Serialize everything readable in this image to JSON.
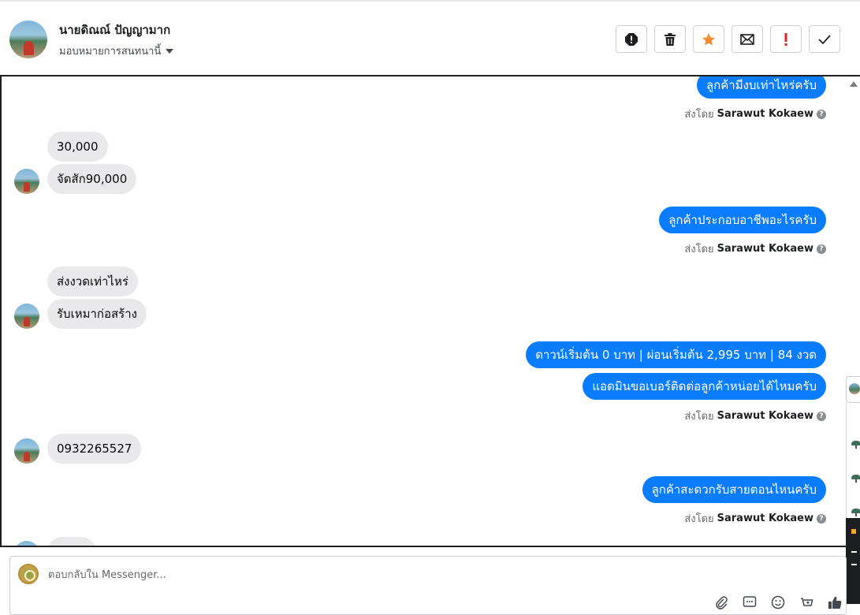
{
  "header": {
    "customer_name": "นายดิณณ์ ปัญญามาก",
    "assign_label": "มอบหมายการสนทนานี้"
  },
  "toolbar": {
    "buttons": [
      {
        "icon": "alert-circle-icon"
      },
      {
        "icon": "trash-icon"
      },
      {
        "icon": "star-icon",
        "color": "#f58e2d"
      },
      {
        "icon": "envelope-icon"
      },
      {
        "icon": "exclamation-icon",
        "color": "#e02424"
      },
      {
        "icon": "check-icon"
      }
    ]
  },
  "conversation": {
    "sent_by_prefix": "ส่งโดย",
    "agent_name": "Sarawut Kokaew",
    "messages": [
      {
        "dir": "out",
        "text": "ลูกค้ามีงบเท่าไหร่ครับ"
      },
      {
        "dir": "in",
        "text": "30,000"
      },
      {
        "dir": "in",
        "text": "จัดสัก90,000"
      },
      {
        "dir": "out",
        "text": "ลูกค้าประกอบอาชีพอะไรครับ"
      },
      {
        "dir": "in",
        "text": "ส่งงวดเท่าไหร่"
      },
      {
        "dir": "in",
        "text": "รับเหมาก่อสร้าง"
      },
      {
        "dir": "out",
        "text": "ดาวน์เริ่มต้น 0 บาท | ผ่อนเริ่มต้น 2,995 บาท | 84 งวด"
      },
      {
        "dir": "out",
        "text": "แอดมินขอเบอร์ติดต่อลูกค้าหน่อยได้ไหมครับ"
      },
      {
        "dir": "in",
        "text": "0932265527"
      },
      {
        "dir": "out",
        "text": "ลูกค้าสะดวกรับสายตอนไหนครับ"
      }
    ]
  },
  "composer": {
    "placeholder": "ตอบกลับใน Messenger...",
    "tools": [
      "paperclip-icon",
      "saved-reply-icon",
      "emoji-icon",
      "add-product-icon",
      "thumbs-up-icon"
    ]
  },
  "colors": {
    "outgoing_bubble": "#0a7cff",
    "incoming_bubble": "#e9e9eb"
  }
}
